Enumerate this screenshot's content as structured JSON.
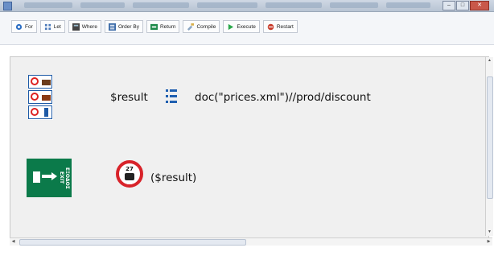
{
  "window": {
    "close_glyph": "✕",
    "minimize_glyph": "–",
    "maximize_glyph": "□"
  },
  "toolbar": {
    "buttons": [
      {
        "label": "For",
        "icon": "for-icon",
        "color": "#2d6fc4"
      },
      {
        "label": "Let",
        "icon": "let-icon",
        "color": "#4a78b8"
      },
      {
        "label": "Where",
        "icon": "where-icon",
        "color": "#444444"
      },
      {
        "label": "Order By",
        "icon": "order-by-icon",
        "color": "#3a6aa8"
      },
      {
        "label": "Return",
        "icon": "return-icon",
        "color": "#1d8a4a"
      },
      {
        "label": "Compile",
        "icon": "compile-icon",
        "color": "#8aa6c4"
      },
      {
        "label": "Execute",
        "icon": "execute-icon",
        "color": "#2aa84a"
      },
      {
        "label": "Restart",
        "icon": "restart-icon",
        "color": "#c83a2a"
      }
    ]
  },
  "editor": {
    "line1": {
      "variable": "$result",
      "expression": "doc(\"prices.xml\")//prod/discount"
    },
    "line2": {
      "sign_number": "27",
      "expression": "($result)"
    },
    "exit_sign_text": "ΕΞΟΔΟΣ EXIT"
  },
  "scrollbars": {
    "up_arrow": "▲",
    "down_arrow": "▼",
    "left_arrow": "◀",
    "right_arrow": "▶"
  }
}
